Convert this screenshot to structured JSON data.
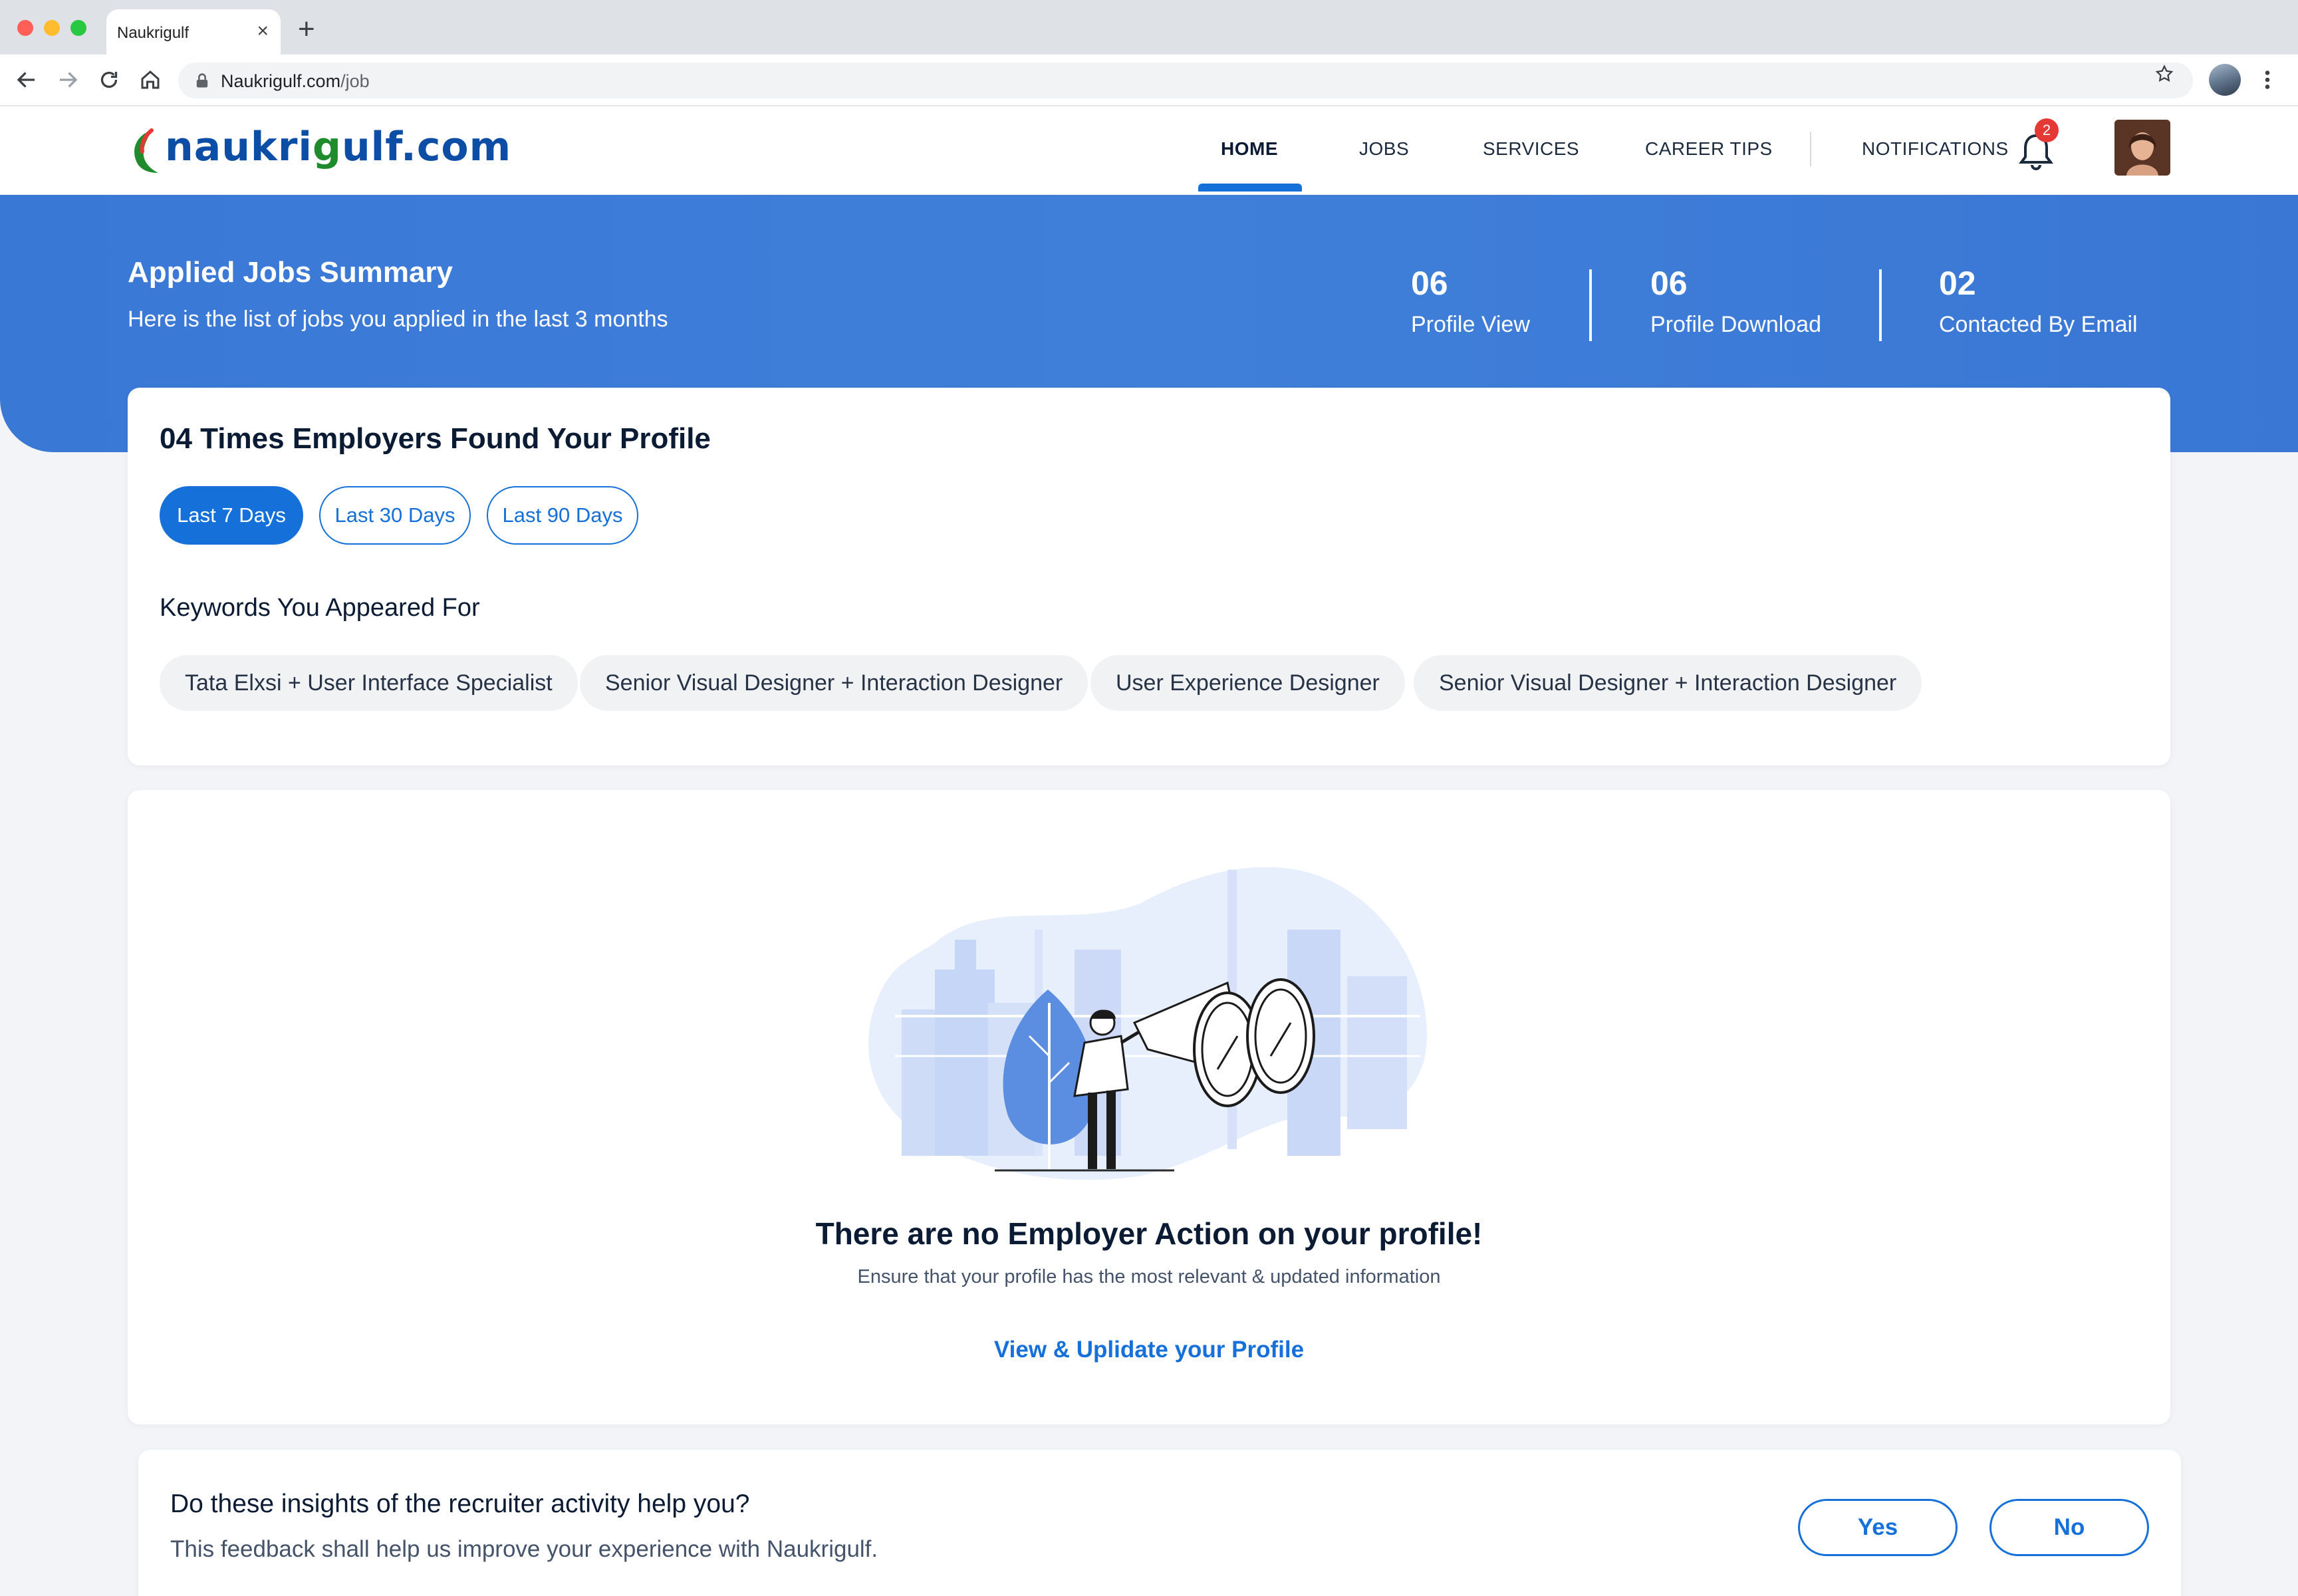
{
  "browser": {
    "tab_title": "Naukrigulf",
    "tab_close": "×",
    "new_tab": "+",
    "url_host": "Naukrigulf.com",
    "url_path": "/job"
  },
  "header": {
    "logo_prefix": "naukri",
    "logo_g": "g",
    "logo_suffix": "ulf.com",
    "nav": {
      "home": "HOME",
      "jobs": "JOBS",
      "services": "SERVICES",
      "career_tips": "CAREER TIPS",
      "notifications": "NOTIFICATIONS"
    },
    "notification_count": "2"
  },
  "banner": {
    "title": "Applied Jobs Summary",
    "subtitle": "Here is the list of jobs you applied in the last 3 months",
    "stats": [
      {
        "value": "06",
        "label": "Profile View"
      },
      {
        "value": "06",
        "label": "Profile Download"
      },
      {
        "value": "02",
        "label": "Contacted By Email"
      }
    ]
  },
  "employers": {
    "title": "04 Times Employers Found Your Profile",
    "filters": [
      {
        "label": "Last 7 Days",
        "active": true
      },
      {
        "label": "Last 30 Days",
        "active": false
      },
      {
        "label": "Last 90 Days",
        "active": false
      }
    ],
    "keywords_title": "Keywords You Appeared For",
    "keywords": [
      "Tata Elxsi + User Interface Specialist",
      "Senior Visual Designer + Interaction Designer",
      "User Experience Designer",
      "Senior Visual Designer + Interaction Designer"
    ]
  },
  "empty_state": {
    "title": "There are no Employer Action on your profile!",
    "subtitle": "Ensure that your profile has the most relevant & updated information",
    "link": "View & Uplidate your Profile"
  },
  "feedback": {
    "title": "Do these insights of the recruiter activity help you?",
    "subtitle": "This feedback shall help us improve your experience with Naukrigulf.",
    "yes": "Yes",
    "no": "No"
  },
  "colors": {
    "brand_blue": "#1670d9",
    "banner_blue": "#3a78d6",
    "logo_blue": "#0c4ea6",
    "logo_green": "#1e8c2c",
    "badge_red": "#e53935"
  }
}
